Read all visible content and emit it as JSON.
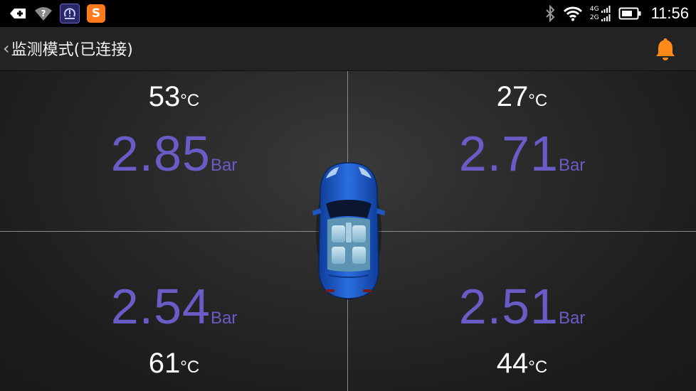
{
  "status_bar": {
    "left_icons": [
      "usb-debug-icon",
      "wifi-help-icon",
      "tpms-app-icon",
      "sogou-app-icon"
    ],
    "sogou_letter": "S",
    "network_top": "4G",
    "network_bottom": "2G",
    "right_icons": [
      "bluetooth-icon",
      "wifi-icon",
      "signal-icon",
      "battery-icon"
    ],
    "time": "11:56"
  },
  "action_bar": {
    "back_glyph": "‹",
    "title": "监测模式(已连接)",
    "alarm_icon": "bell-icon",
    "accent_color": "#ff8a1a"
  },
  "tyres": {
    "front_left": {
      "temp": "53",
      "temp_unit": "°C",
      "pressure": "2.85",
      "pressure_unit": "Bar"
    },
    "front_right": {
      "temp": "27",
      "temp_unit": "°C",
      "pressure": "2.71",
      "pressure_unit": "Bar"
    },
    "rear_left": {
      "temp": "61",
      "temp_unit": "°C",
      "pressure": "2.54",
      "pressure_unit": "Bar"
    },
    "rear_right": {
      "temp": "44",
      "temp_unit": "°C",
      "pressure": "2.51",
      "pressure_unit": "Bar"
    }
  },
  "colors": {
    "pressure": "#6a5cc6",
    "temperature": "#ffffff",
    "car_body": "#1e5bc7"
  },
  "car_icon": "car-top-view-icon"
}
